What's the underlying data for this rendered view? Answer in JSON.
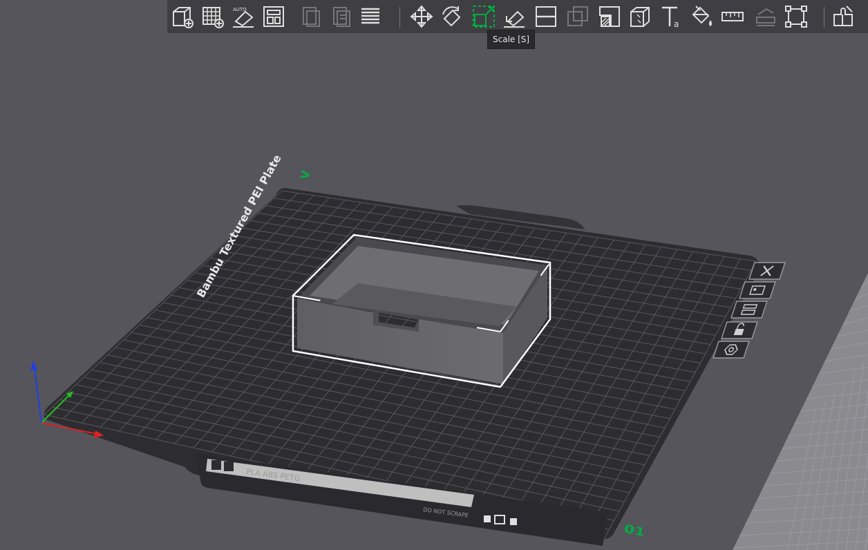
{
  "toolbar": {
    "items": [
      {
        "name": "add-icon",
        "label": "Add"
      },
      {
        "name": "add-plate-icon",
        "label": "Add Plate"
      },
      {
        "name": "auto-orient-icon",
        "label": "Auto Orient",
        "badge": "AUTO"
      },
      {
        "name": "arrange-icon",
        "label": "Arrange"
      },
      {
        "name": "copy-icon",
        "label": "Copy"
      },
      {
        "name": "paste-icon",
        "label": "Paste"
      },
      {
        "name": "layers-icon",
        "label": "Layers"
      },
      {
        "name": "move-icon",
        "label": "Move"
      },
      {
        "name": "rotate-icon",
        "label": "Rotate"
      },
      {
        "name": "scale-icon",
        "label": "Scale"
      },
      {
        "name": "lay-on-face-icon",
        "label": "Lay on Face"
      },
      {
        "name": "cut-icon",
        "label": "Cut"
      },
      {
        "name": "boolean-icon",
        "label": "Mesh Boolean"
      },
      {
        "name": "support-paint-icon",
        "label": "Support Painting"
      },
      {
        "name": "seam-paint-icon",
        "label": "Seam Painting"
      },
      {
        "name": "text-icon",
        "label": "Text",
        "badge": "a"
      },
      {
        "name": "color-paint-icon",
        "label": "Color Painting"
      },
      {
        "name": "measure-icon",
        "label": "Measure"
      },
      {
        "name": "assembly-icon",
        "label": "Assembly"
      },
      {
        "name": "fit-view-icon",
        "label": "Fit View"
      },
      {
        "name": "split-parts-icon",
        "label": "Split to Parts"
      }
    ],
    "tooltip": "Scale [S]"
  },
  "plate": {
    "name": "Bambu Textured PEI Plate",
    "number": "01",
    "label_strip": "PLA ABS PETG",
    "small_label": "DO NOT SCRAPE",
    "axis_mark": "V",
    "side_icons": [
      {
        "name": "delete-plate-icon"
      },
      {
        "name": "arrange-plate-icon"
      },
      {
        "name": "orient-plate-icon"
      },
      {
        "name": "lock-plate-icon"
      },
      {
        "name": "plate-settings-icon"
      }
    ]
  },
  "colors": {
    "background": "#55555b",
    "toolbar": "#3f3f43",
    "icon": "#e0e0e0",
    "accent": "#00ae42",
    "plate": "#2d2d31",
    "grid": "#5a5a60"
  }
}
